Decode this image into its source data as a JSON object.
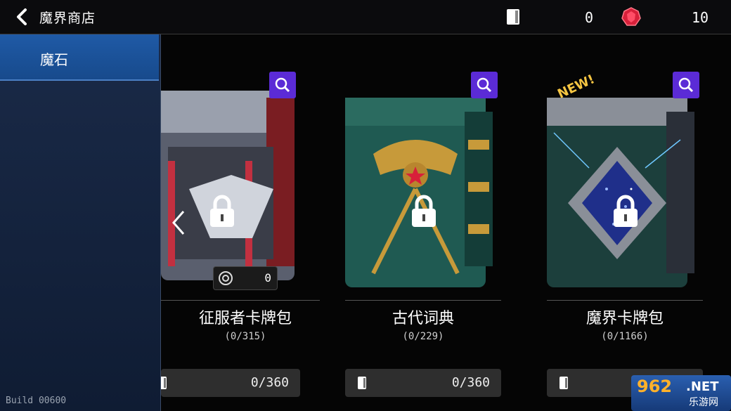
{
  "header": {
    "title": "魔界商店",
    "resources": [
      {
        "icon": "card-icon",
        "value": "0"
      },
      {
        "icon": "red-gem-icon",
        "value": "10"
      }
    ]
  },
  "sidebar": {
    "items": [
      {
        "label": "魔石",
        "selected": true
      }
    ],
    "build": "Build 00600"
  },
  "packs": [
    {
      "name": "征服者卡牌包",
      "count": "(0/315)",
      "price": "0/360",
      "owned": "0",
      "new": false,
      "locked": true
    },
    {
      "name": "古代词典",
      "count": "(0/229)",
      "price": "0/360",
      "new": false,
      "locked": true
    },
    {
      "name": "魔界卡牌包",
      "count": "(0/1166)",
      "new": true,
      "new_label": "NEW!",
      "locked": true
    }
  ],
  "watermark": {
    "brand": "962",
    "suffix": ".NET",
    "site": "乐游网"
  },
  "colors": {
    "accent": "#5b2bd6",
    "sidebar_selected": "#1f5aa6",
    "gem": "#d8203a"
  }
}
